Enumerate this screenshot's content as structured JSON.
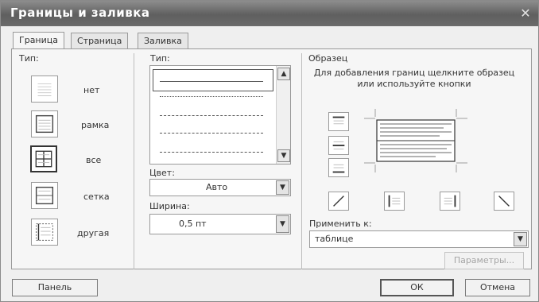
{
  "window": {
    "title": "Границы и заливка",
    "close_glyph": "✕"
  },
  "tabs": [
    {
      "label": "Граница",
      "active": true
    },
    {
      "label": "Страница",
      "active": false
    },
    {
      "label": "Заливка",
      "active": false
    }
  ],
  "presets": {
    "heading": "Тип:",
    "items": [
      {
        "label": "нет",
        "selected": false
      },
      {
        "label": "рамка",
        "selected": false
      },
      {
        "label": "все",
        "selected": true
      },
      {
        "label": "сетка",
        "selected": false
      },
      {
        "label": "другая",
        "selected": false
      }
    ]
  },
  "style": {
    "heading": "Тип:",
    "color_label": "Цвет:",
    "color_value": "Авто",
    "width_label": "Ширина:",
    "width_value": "0,5 пт",
    "scroll_up": "▲",
    "scroll_down": "▼",
    "dropdown_glyph": "▼"
  },
  "preview": {
    "heading": "Образец",
    "hint": "Для добавления границ щелкните образец или используйте кнопки",
    "apply_to_label": "Применить к:",
    "apply_to_value": "таблице",
    "options_button": "Параметры..."
  },
  "footer": {
    "panel_button": "Панель",
    "ok_button": "ОК",
    "cancel_button": "Отмена"
  }
}
